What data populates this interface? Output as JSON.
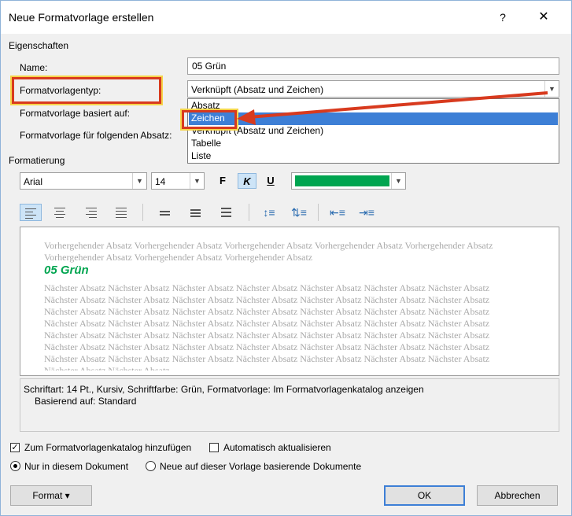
{
  "window": {
    "title": "Neue Formatvorlage erstellen",
    "help": "?",
    "close": "✕"
  },
  "properties": {
    "section": "Eigenschaften",
    "name_label": "Name:",
    "name_value": "05 Grün",
    "type_label": "Formatvorlagentyp:",
    "type_value": "Verknüpft (Absatz und Zeichen)",
    "based_label": "Formatvorlage basiert auf:",
    "next_label": "Formatvorlage für folgenden Absatz:"
  },
  "dropdown": {
    "options": [
      "Absatz",
      "Zeichen",
      "Verknüpft (Absatz und Zeichen)",
      "Tabelle",
      "Liste"
    ],
    "highlighted": "Zeichen"
  },
  "formatting": {
    "section": "Formatierung",
    "font": "Arial",
    "size": "14",
    "bold": "F",
    "italic": "K",
    "underline": "U",
    "color": "#00a550"
  },
  "preview": {
    "previous": "Vorhergehender Absatz Vorhergehender Absatz Vorhergehender Absatz Vorhergehender Absatz Vorhergehender Absatz Vorhergehender Absatz Vorhergehender Absatz Vorhergehender Absatz",
    "sample": "05 Grün",
    "next": "Nächster Absatz Nächster Absatz Nächster Absatz Nächster Absatz Nächster Absatz Nächster Absatz Nächster Absatz Nächster Absatz Nächster Absatz Nächster Absatz Nächster Absatz Nächster Absatz Nächster Absatz Nächster Absatz Nächster Absatz Nächster Absatz Nächster Absatz Nächster Absatz Nächster Absatz Nächster Absatz Nächster Absatz Nächster Absatz Nächster Absatz Nächster Absatz Nächster Absatz Nächster Absatz Nächster Absatz Nächster Absatz Nächster Absatz Nächster Absatz Nächster Absatz Nächster Absatz Nächster Absatz Nächster Absatz Nächster Absatz Nächster Absatz Nächster Absatz Nächster Absatz Nächster Absatz Nächster Absatz Nächster Absatz Nächster Absatz Nächster Absatz Nächster Absatz Nächster Absatz Nächster Absatz Nächster Absatz Nächster Absatz Nächster Absatz Nächster Absatz Nächster Absatz"
  },
  "description": {
    "line1": "Schriftart: 14 Pt., Kursiv, Schriftfarbe: Grün, Formatvorlage: Im Formatvorlagenkatalog anzeigen",
    "line2": "Basierend auf: Standard"
  },
  "options": {
    "add_gallery": "Zum Formatvorlagenkatalog hinzufügen",
    "auto_update": "Automatisch aktualisieren",
    "only_doc": "Nur in diesem Dokument",
    "new_docs": "Neue auf dieser Vorlage basierende Dokumente"
  },
  "buttons": {
    "format": "Format ▾",
    "ok": "OK",
    "cancel": "Abbrechen"
  }
}
